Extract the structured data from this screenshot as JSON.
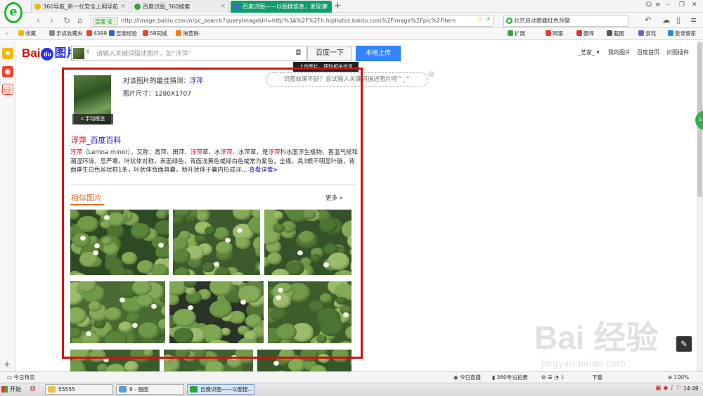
{
  "browser": {
    "logo": "e",
    "tabs": [
      {
        "label": "360导航_新一代安全上网导航",
        "icon_color": "#f5b800",
        "active": false
      },
      {
        "label": "百度识图_360搜索",
        "icon_color": "#3aa43a",
        "active": false
      },
      {
        "label": "百度识图——以图搜信息，发现身",
        "icon_color": "#3a6fd6",
        "active": true
      }
    ],
    "new_tab": "+",
    "address": {
      "site_badge": "百度 证 ·",
      "url": "http://image.baidu.com/n/pc_search?queryImageUrl=http%3A%2F%2Fh.hiphotos.baidu.com%2Fimage%2Fpic%2Fitem"
    },
    "search_box": "北京启动雾霾红色预警",
    "bookmarks": [
      {
        "label": "收藏",
        "color": "#f5b800"
      },
      {
        "label": "手机收藏夹",
        "color": "#888888"
      },
      {
        "label": "4399",
        "color": "#e8462b"
      },
      {
        "label": "百度经验",
        "color": "#2f63d4"
      },
      {
        "label": "58同城",
        "color": "#e8462b"
      },
      {
        "label": "淘营销-",
        "color": "#ff7a00"
      }
    ],
    "toolbar_items": [
      "扩展",
      "网银",
      "翻译",
      "截图",
      "游戏",
      "登录管家"
    ]
  },
  "baidu": {
    "logo_text": "Bai",
    "logo_paw": "du",
    "logo_pic": "图片",
    "search_placeholder": "请输入关键词描述图片，如“浮萍”",
    "search_clear": "X",
    "search_button": "百度一下",
    "upload_button": "本地上传",
    "top_links": [
      "_艺家_",
      "我的图片",
      "百度首页",
      "识图插件"
    ],
    "tip_text": "上传图片，获取相关信息",
    "hint_text": "识图效果不好？尝试输入关键词描述图片吧^_^",
    "manual_select": "手动框选",
    "guess_prefix": "对该图片的最佳猜测：",
    "guess_value": "浮萍",
    "size_label": "图片尺寸：1280X1707",
    "baike_title_hl": "浮萍",
    "baike_title_rest": "_百度百科",
    "baike_text_1": "浮萍",
    "baike_text_2": "（Lemna minor），又称：青萍、田萍、",
    "baike_text_3": "浮萍",
    "baike_text_4": "草、水",
    "baike_text_5": "浮萍",
    "baike_text_6": "、水萍草，是",
    "baike_text_7": "浮萍",
    "baike_text_8": "科水面浮生植物。喜温气候和潮湿环境，忌严寒。叶状体对称，表面绿色，背面浅黄色或绿白色或常为紫色，全缘，具3根不明显叶脉，背面垂生白色丝状根1条，叶状体背面具囊，新叶状体于囊内形成浮... ",
    "baike_more": "查看详情>",
    "similar_title": "相似图片",
    "similar_more": "更多 »",
    "similar_images": [
      {
        "flowers": 5,
        "water": "#2e4a25"
      },
      {
        "flowers": 3,
        "water": "#3c5a2d"
      },
      {
        "flowers": 2,
        "water": "#35522a"
      },
      {
        "flowers": 4,
        "water": "#4a6a33"
      },
      {
        "flowers": 2,
        "water": "#2a3328"
      },
      {
        "flowers": 3,
        "water": "#3e5f2c"
      },
      {
        "flowers": 1,
        "water": "#3a5a2c"
      },
      {
        "flowers": 1,
        "water": "#405e2e"
      },
      {
        "flowers": 1,
        "water": "#365529"
      }
    ]
  },
  "watermark": {
    "logo": "Bai  经验",
    "url": "jingyan.baidu.com"
  },
  "statusbar": {
    "left": "今日特卖",
    "items": [
      "今日直播",
      "360专访拍票",
      "下载",
      "100%"
    ]
  },
  "taskbar": {
    "start": "开始",
    "tasks": [
      "55555",
      "9 - 画图",
      "百度识图——以图搜..."
    ],
    "clock": "14:49"
  },
  "colors": {
    "accent_red": "#d40f0f",
    "baidu_blue": "#3385ff",
    "link": "#1a0dab",
    "similar_orange": "#e26e2c"
  }
}
